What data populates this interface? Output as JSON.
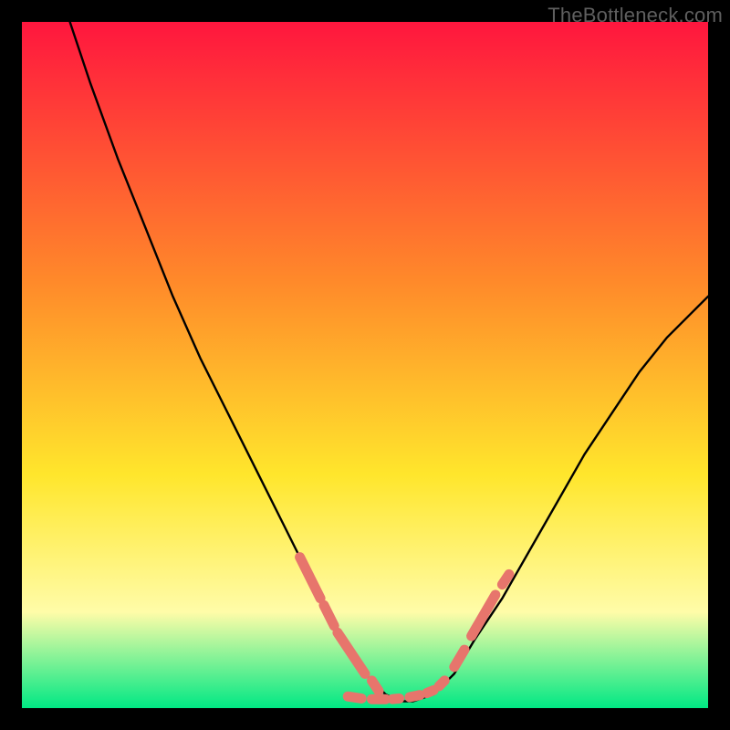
{
  "brand": "TheBottleneck.com",
  "colors": {
    "gradient_top": "#ff163e",
    "gradient_upper_mid": "#ff8a2a",
    "gradient_mid": "#ffe62c",
    "gradient_lower": "#fffca8",
    "gradient_bottom": "#00e884",
    "curve": "#000000",
    "beads": "#e7756c",
    "frame": "#000000"
  },
  "chart_data": {
    "type": "line",
    "title": "",
    "xlabel": "",
    "ylabel": "",
    "xlim": [
      0,
      100
    ],
    "ylim": [
      0,
      100
    ],
    "series": [
      {
        "name": "bottleneck-curve",
        "x": [
          7,
          10,
          14,
          18,
          22,
          26,
          30,
          34,
          38,
          41,
          44,
          47,
          50,
          53,
          55,
          57,
          60,
          63,
          66,
          70,
          74,
          78,
          82,
          86,
          90,
          94,
          98,
          100
        ],
        "y": [
          100,
          91,
          80,
          70,
          60,
          51,
          43,
          35,
          27,
          21,
          15,
          10,
          5,
          2,
          1,
          1,
          2,
          5,
          10,
          16,
          23,
          30,
          37,
          43,
          49,
          54,
          58,
          60
        ]
      }
    ],
    "highlight_points": {
      "name": "beaded-segments",
      "segments": [
        {
          "x": [
            40.5,
            43.5
          ],
          "y": [
            22,
            16
          ]
        },
        {
          "x": [
            44.0,
            45.5
          ],
          "y": [
            15,
            12
          ]
        },
        {
          "x": [
            46.0,
            50.0
          ],
          "y": [
            11,
            5
          ]
        },
        {
          "x": [
            51.0,
            52.0
          ],
          "y": [
            4,
            2.5
          ]
        },
        {
          "x": [
            47.5,
            49.5
          ],
          "y": [
            1.7,
            1.4
          ]
        },
        {
          "x": [
            51.0,
            53.0
          ],
          "y": [
            1.3,
            1.3
          ]
        },
        {
          "x": [
            54.0,
            55.0
          ],
          "y": [
            1.3,
            1.4
          ]
        },
        {
          "x": [
            56.5,
            58.0
          ],
          "y": [
            1.6,
            1.9
          ]
        },
        {
          "x": [
            59.0,
            60.0
          ],
          "y": [
            2.2,
            2.6
          ]
        },
        {
          "x": [
            60.8,
            61.6
          ],
          "y": [
            3.2,
            4.0
          ]
        },
        {
          "x": [
            63.0,
            64.5
          ],
          "y": [
            6,
            8.5
          ]
        },
        {
          "x": [
            65.5,
            69.0
          ],
          "y": [
            10.5,
            16.5
          ]
        },
        {
          "x": [
            70.0,
            71.0
          ],
          "y": [
            18,
            19.5
          ]
        }
      ]
    }
  }
}
